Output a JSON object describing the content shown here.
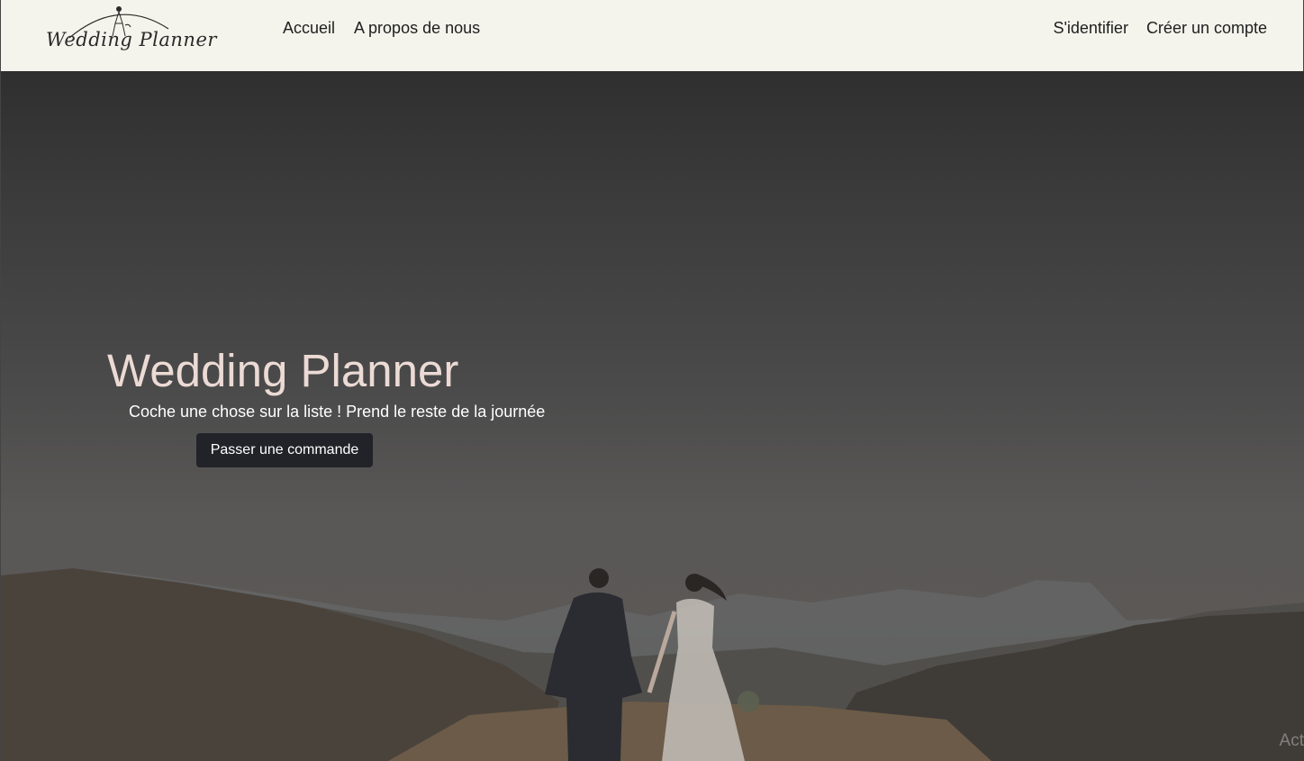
{
  "navbar": {
    "logo_text": "Wedding Planner",
    "links_left": [
      "Accueil",
      "A propos de nous"
    ],
    "links_right": [
      "S'identifier",
      "Créer un compte"
    ]
  },
  "hero": {
    "title": "Wedding Planner",
    "subtitle": "Coche une chose sur la liste ! Prend le reste de la journée",
    "cta_label": "Passer une commande",
    "watermark": "Act"
  },
  "colors": {
    "navbar_bg": "#f4f4ec",
    "hero_title": "#ecdad5",
    "button_bg": "#212329"
  }
}
